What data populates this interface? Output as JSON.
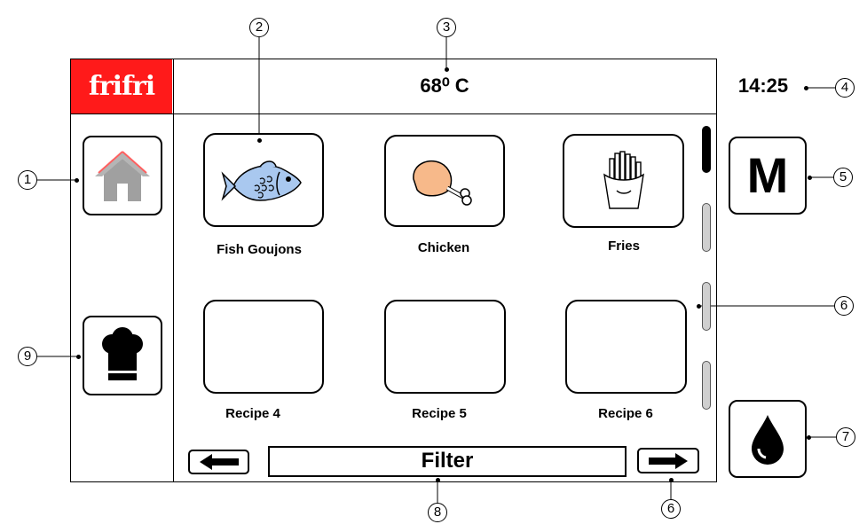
{
  "header": {
    "logo_text": "frifri",
    "temperature": "68⁰ C",
    "time": "14:25"
  },
  "sidebar_left": {
    "home_icon": "home-icon",
    "chef_icon": "chef-hat-icon"
  },
  "sidebar_right": {
    "menu_label": "M",
    "oil_icon": "oil-drop-icon"
  },
  "recipes": [
    {
      "label": "Fish Goujons",
      "icon": "fish-icon"
    },
    {
      "label": "Chicken",
      "icon": "chicken-leg-icon"
    },
    {
      "label": "Fries",
      "icon": "fries-icon"
    },
    {
      "label": "Recipe 4",
      "icon": ""
    },
    {
      "label": "Recipe 5",
      "icon": ""
    },
    {
      "label": "Recipe 6",
      "icon": ""
    }
  ],
  "scroll_indicator": {
    "segments": 4,
    "active_segment": 1
  },
  "footer": {
    "filter_label": "Filter",
    "prev_icon": "arrow-left-icon",
    "next_icon": "arrow-right-icon"
  },
  "callouts": [
    "1",
    "2",
    "3",
    "4",
    "5",
    "6",
    "6",
    "7",
    "8",
    "9"
  ],
  "colors": {
    "brand_red": "#ff1a1a",
    "fish_blue": "#a9c8ef",
    "chicken_skin": "#f7b98a",
    "scroll_inactive": "#cfcfcf"
  }
}
